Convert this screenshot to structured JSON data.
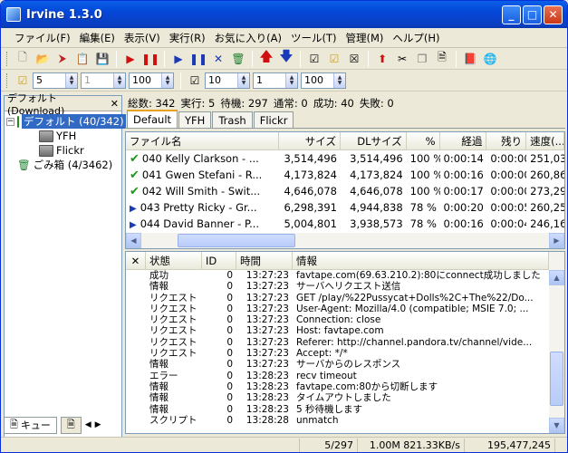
{
  "window": {
    "title": "Irvine 1.3.0"
  },
  "menu": [
    "ファイル(F)",
    "編集(E)",
    "表示(V)",
    "実行(R)",
    "お気に入り(A)",
    "ツール(T)",
    "管理(M)",
    "ヘルプ(H)"
  ],
  "toolbar2": {
    "spin1": "5",
    "spin2": "1",
    "spin3": "100",
    "spin4": "10",
    "spin5": "1",
    "spin6": "100"
  },
  "left": {
    "header": "デフォルト (Download)",
    "tree": [
      {
        "label": "デフォルト (40/342)",
        "selected": true
      },
      {
        "label": "YFH"
      },
      {
        "label": "Flickr"
      },
      {
        "label": "ごみ箱 (4/3462)"
      }
    ],
    "tab_queue": "キュー"
  },
  "status_line": {
    "total": "総数: 342",
    "running": "実行: 5",
    "waiting": "待機: 297",
    "normal": "通常: 0",
    "success": "成功: 40",
    "fail": "失敗: 0"
  },
  "tabs": [
    "Default",
    "YFH",
    "Trash",
    "Flickr"
  ],
  "grid": {
    "headers": [
      "ファイル名",
      "サイズ",
      "DLサイズ",
      "%",
      "経過",
      "残り",
      "速度(..."
    ],
    "rows": [
      {
        "status": "done",
        "name": "040 Kelly Clarkson - ...",
        "size": "3,514,496",
        "dl": "3,514,496",
        "pct": "100 %",
        "elapsed": "0:00:14",
        "remain": "0:00:00",
        "speed": "251,03"
      },
      {
        "status": "done",
        "name": "041 Gwen Stefani - R...",
        "size": "4,173,824",
        "dl": "4,173,824",
        "pct": "100 %",
        "elapsed": "0:00:16",
        "remain": "0:00:00",
        "speed": "260,86"
      },
      {
        "status": "done",
        "name": "042 Will Smith - Swit...",
        "size": "4,646,078",
        "dl": "4,646,078",
        "pct": "100 %",
        "elapsed": "0:00:17",
        "remain": "0:00:00",
        "speed": "273,29"
      },
      {
        "status": "run",
        "name": "043 Pretty Ricky - Gr...",
        "size": "6,298,391",
        "dl": "4,944,838",
        "pct": "78 %",
        "elapsed": "0:00:20",
        "remain": "0:00:05",
        "speed": "260,25"
      },
      {
        "status": "run",
        "name": "044 David Banner - P...",
        "size": "5,004,801",
        "dl": "3,938,573",
        "pct": "78 %",
        "elapsed": "0:00:16",
        "remain": "0:00:04",
        "speed": "246,16"
      }
    ]
  },
  "log": {
    "headers": [
      "状態",
      "ID",
      "時間",
      "情報"
    ],
    "rows": [
      [
        "成功",
        "0",
        "13:27:23",
        "favtape.com(69.63.210.2):80にconnect成功しました"
      ],
      [
        "情報",
        "0",
        "13:27:23",
        "サーバへリクエスト送信"
      ],
      [
        "リクエスト",
        "0",
        "13:27:23",
        "GET /play/%22Pussycat+Dolls%2C+The%22/Do..."
      ],
      [
        "リクエスト",
        "0",
        "13:27:23",
        "User-Agent: Mozilla/4.0 (compatible; MSIE 7.0; ..."
      ],
      [
        "リクエスト",
        "0",
        "13:27:23",
        "Connection: close"
      ],
      [
        "リクエスト",
        "0",
        "13:27:23",
        "Host: favtape.com"
      ],
      [
        "リクエスト",
        "0",
        "13:27:23",
        "Referer: http://channel.pandora.tv/channel/vide..."
      ],
      [
        "リクエスト",
        "0",
        "13:27:23",
        "Accept: */*"
      ],
      [
        "情報",
        "0",
        "13:27:23",
        "サーバからのレスポンス"
      ],
      [
        "エラー",
        "0",
        "13:28:23",
        "recv timeout"
      ],
      [
        "情報",
        "0",
        "13:28:23",
        "favtape.com:80から切断します"
      ],
      [
        "情報",
        "0",
        "13:28:23",
        "タイムアウトしました"
      ],
      [
        "情報",
        "0",
        "13:28:23",
        "5 秒待機します"
      ],
      [
        "スクリプト",
        "0",
        "13:28:28",
        "unmatch"
      ]
    ]
  },
  "statusbar": {
    "count": "5/297",
    "memory": "1.00M 821.33KB/s",
    "bytes": "195,477,245"
  }
}
